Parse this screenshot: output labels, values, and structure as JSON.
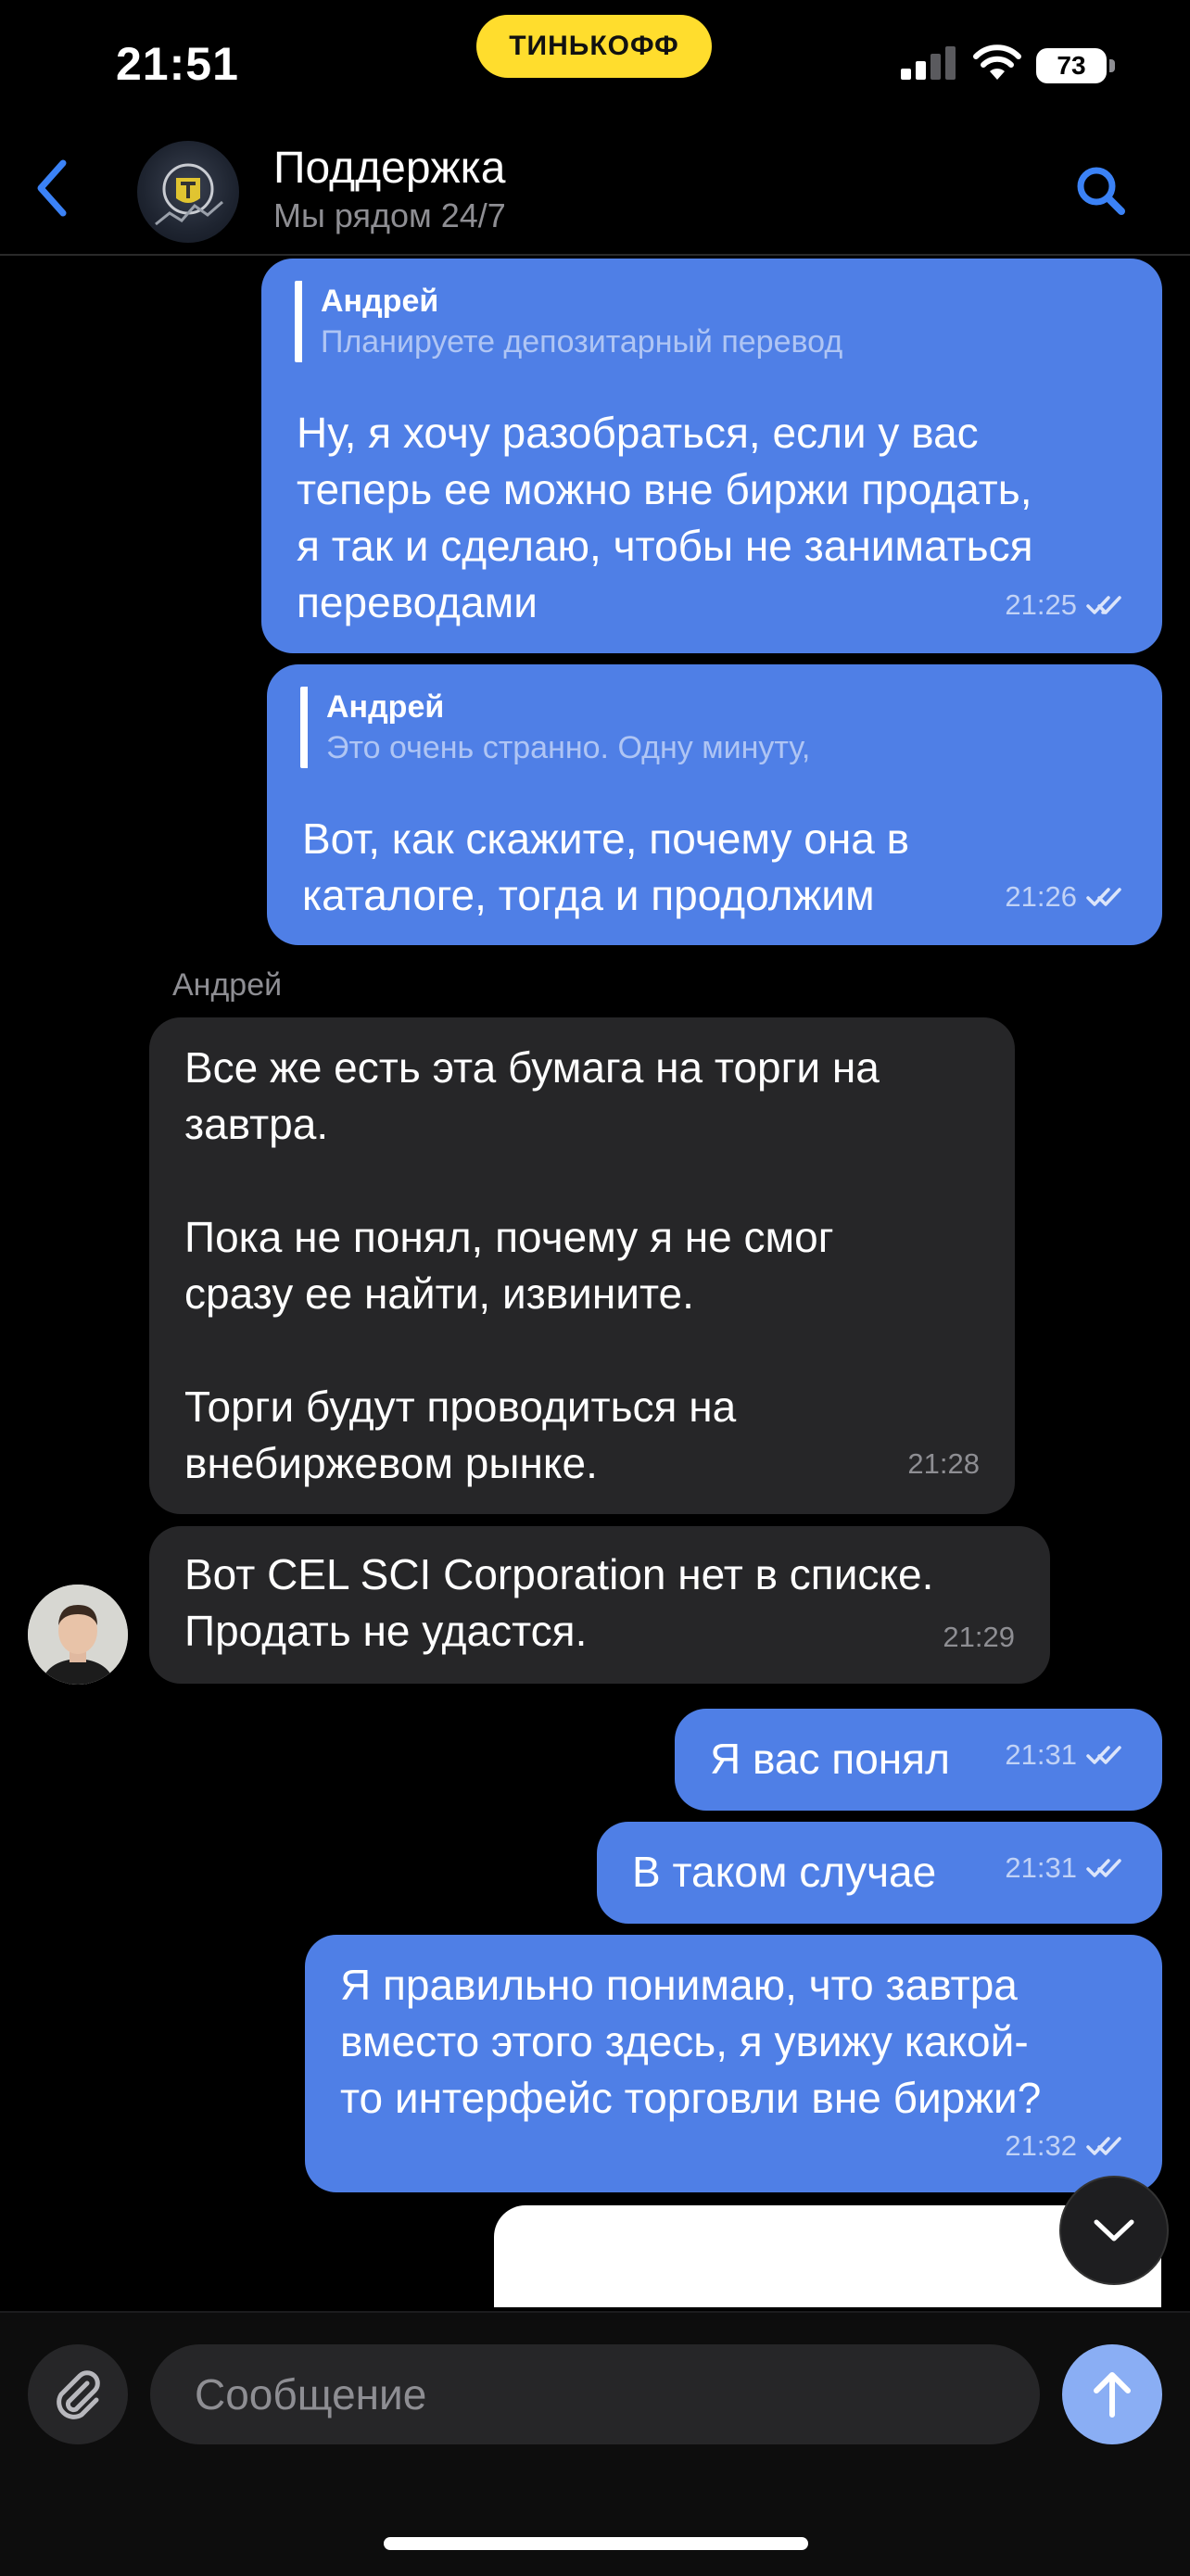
{
  "status_bar": {
    "time": "21:51",
    "brand": "ТИНЬКОФФ",
    "battery": "73"
  },
  "header": {
    "title": "Поддержка",
    "subtitle": "Мы рядом 24/7"
  },
  "messages": [
    {
      "reply_name": "Андрей",
      "reply_text": "Планируете депозитарный перевод",
      "text": "Ну, я хочу разобраться, если у вас\nтеперь ее можно вне биржи продать,\nя так и сделаю, чтобы не заниматься\nпереводами",
      "time": "21:25"
    },
    {
      "reply_name": "Андрей",
      "reply_text": "Это очень странно. Одну минуту,",
      "text": "Вот, как скажите, почему она в\nкаталоге, тогда и продолжим",
      "time": "21:26"
    },
    {
      "sender": "Андрей",
      "text": "Все же есть эта бумага на торги на\nзавтра.\n\nПока не понял, почему я не смог\nсразу ее найти, извините.\n\nТорги будут проводиться на\nвнебиржевом рынке.",
      "time": "21:28"
    },
    {
      "text": "Вот CEL SCI Corporation нет в списке.\nПродать не удастся.",
      "time": "21:29"
    },
    {
      "text": "Я вас понял",
      "time": "21:31"
    },
    {
      "text": "В таком случае",
      "time": "21:31"
    },
    {
      "text": "Я правильно понимаю, что завтра\nвместо этого здесь, я увижу какой-\nто интерфейс торговли вне биржи?",
      "time": "21:32"
    }
  ],
  "composer": {
    "placeholder": "Сообщение"
  },
  "colors": {
    "outgoing": "#4f7fe6",
    "incoming": "#262628",
    "accent": "#3b82f6",
    "brand_pill": "#ffdd2d"
  }
}
